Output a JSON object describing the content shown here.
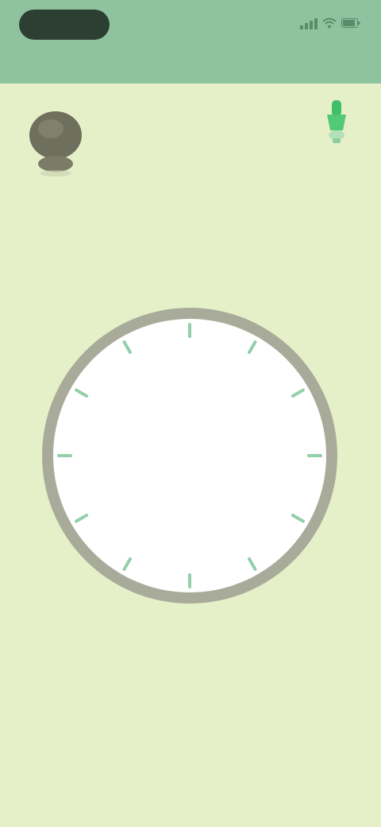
{
  "status_bar": {
    "time": "",
    "indicators": [
      "signal-icon",
      "wifi-icon",
      "battery-icon"
    ]
  },
  "header": {
    "title": ""
  },
  "top_left": {
    "icon": "weather-icon"
  },
  "top_right": {
    "icon": "flashlight-icon",
    "label": ""
  },
  "dial": {
    "label": "",
    "tick_color": "#6fbf8e",
    "ring_color": "#a9ab9a",
    "face_color": "#ffffff"
  },
  "colors": {
    "background": "#e6f0c8",
    "header": "#8fc3a0",
    "accent": "#3fbf6a"
  }
}
